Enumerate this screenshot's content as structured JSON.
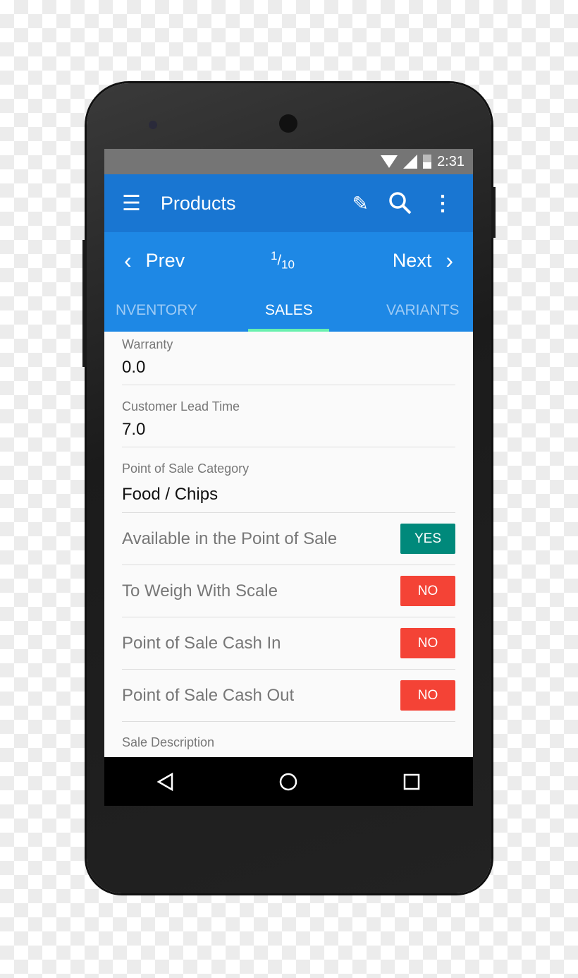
{
  "status_bar": {
    "time": "2:31"
  },
  "app_bar": {
    "title": "Products"
  },
  "record_nav": {
    "prev_label": "Prev",
    "next_label": "Next",
    "current": "1",
    "total": "10"
  },
  "tabs": [
    {
      "label": "NVENTORY",
      "active": false
    },
    {
      "label": "SALES",
      "active": true
    },
    {
      "label": "VARIANTS",
      "active": false
    }
  ],
  "fields": [
    {
      "label": "Warranty",
      "value": "0.0"
    },
    {
      "label": "Customer Lead Time",
      "value": "7.0"
    },
    {
      "label": "Point of Sale Category",
      "value": "Food / Chips"
    }
  ],
  "toggles": [
    {
      "label": "Available in the Point of Sale",
      "value": "YES",
      "color": "#00897b"
    },
    {
      "label": "To Weigh With Scale",
      "value": "NO",
      "color": "#f44336"
    },
    {
      "label": "Point of Sale Cash In",
      "value": "NO",
      "color": "#f44336"
    },
    {
      "label": "Point of Sale Cash Out",
      "value": "NO",
      "color": "#f44336"
    }
  ],
  "trailing_field": {
    "label": "Sale Description"
  },
  "colors": {
    "app_bar": "#1976d2",
    "nav": "#1e88e5",
    "indicator": "#69f0ae"
  }
}
